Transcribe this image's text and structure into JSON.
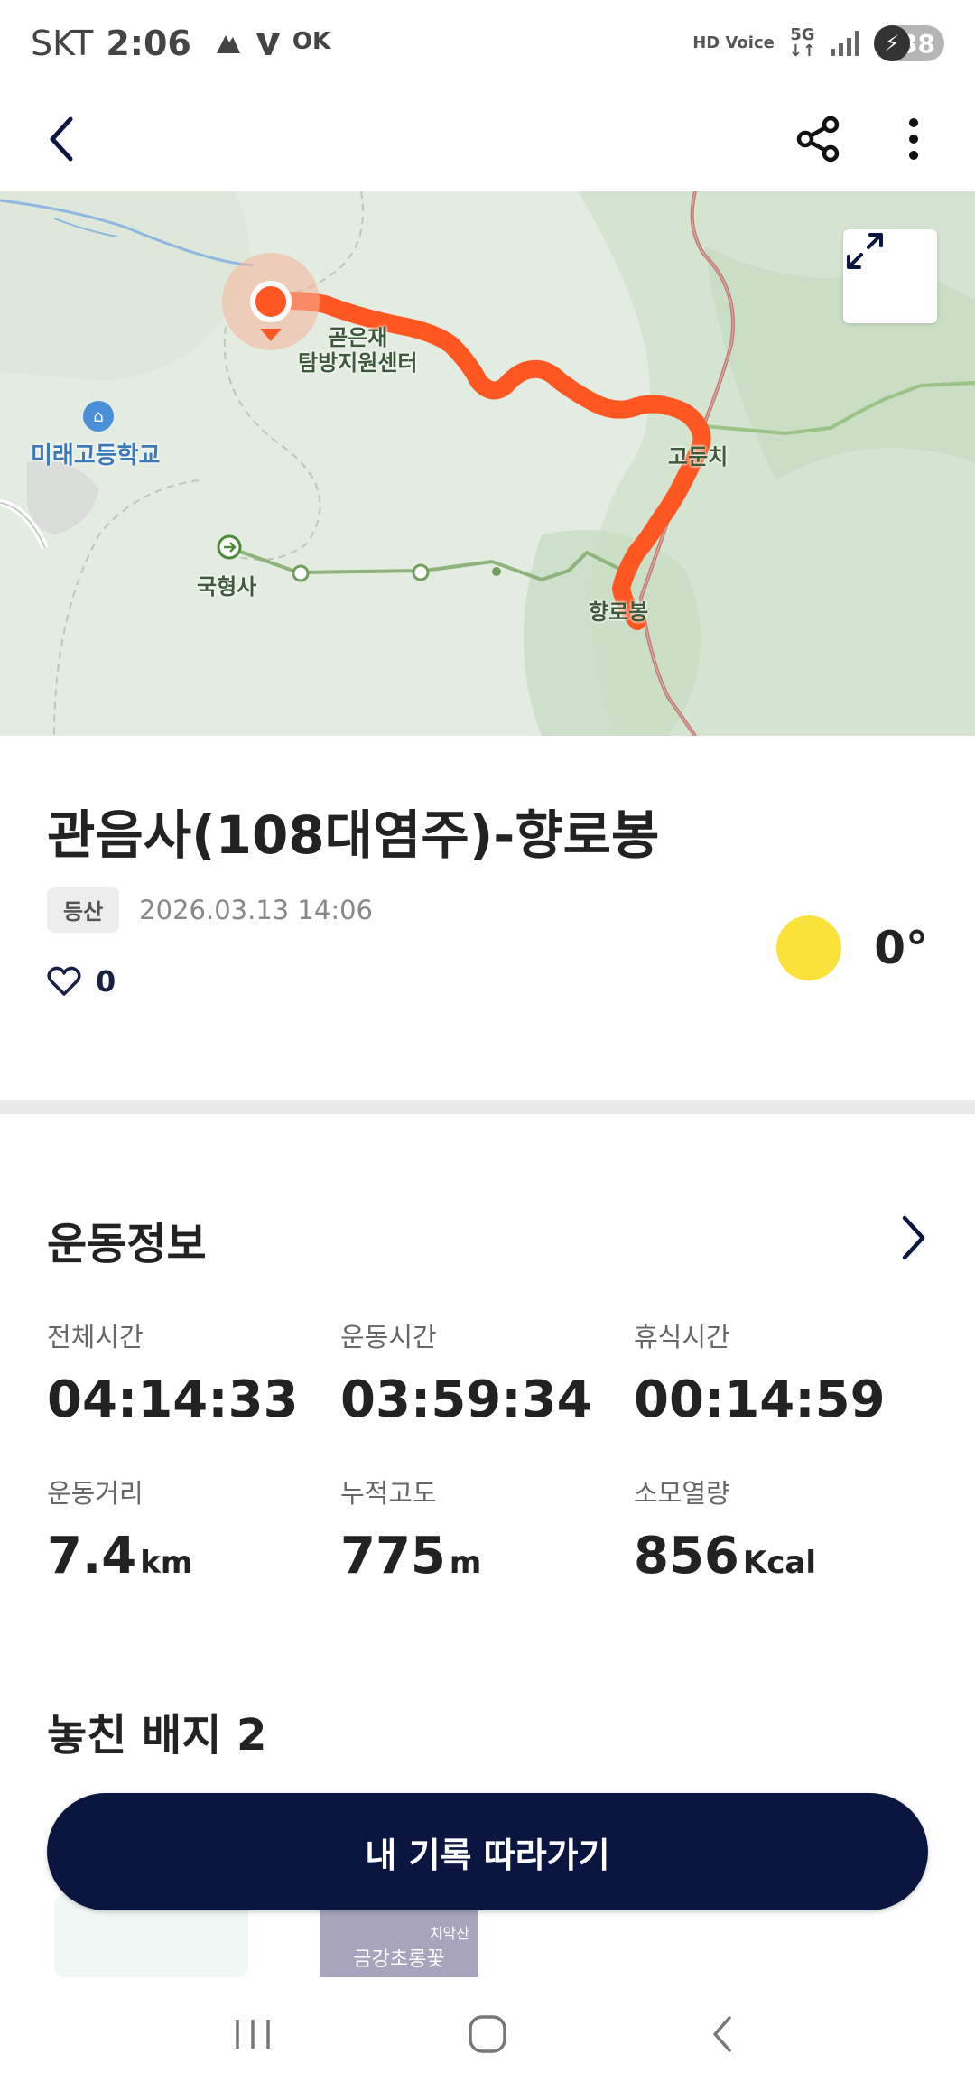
{
  "status_bar": {
    "carrier": "SKT",
    "time": "2:06",
    "left_icons": [
      "notification-icon",
      "app-icon",
      "ok-icon"
    ],
    "ok_text": "OK",
    "hd_voice": "HD Voice",
    "network": "5G",
    "battery": "38"
  },
  "map": {
    "labels": {
      "start_place_line1": "곧은재",
      "start_place_line2": "탐방지원센터",
      "school": "미래고등학교",
      "temple": "국형사",
      "pass": "고둔치",
      "peak": "향로봉"
    },
    "route_color": "#fc5a2a"
  },
  "record": {
    "title": "관음사(108대염주)-향로봉",
    "category": "등산",
    "datetime": "2026.03.13 14:06",
    "likes": "0",
    "temperature": "0°"
  },
  "exercise": {
    "section_title": "운동정보",
    "stats": [
      {
        "label": "전체시간",
        "value": "04:14:33",
        "unit": ""
      },
      {
        "label": "운동시간",
        "value": "03:59:34",
        "unit": ""
      },
      {
        "label": "휴식시간",
        "value": "00:14:59",
        "unit": ""
      },
      {
        "label": "운동거리",
        "value": "7.4",
        "unit": "km"
      },
      {
        "label": "누적고도",
        "value": "775",
        "unit": "m"
      },
      {
        "label": "소모열량",
        "value": "856",
        "unit": "Kcal"
      }
    ]
  },
  "badges": {
    "title": "놓친 배지 2",
    "thumb2_small": "치악산",
    "thumb2_name": "금강초롱꽃"
  },
  "follow_button": "내 기록 따라가기",
  "colors": {
    "primary": "#0a1640",
    "route": "#fc5a2a",
    "sun": "#fbe23a"
  }
}
